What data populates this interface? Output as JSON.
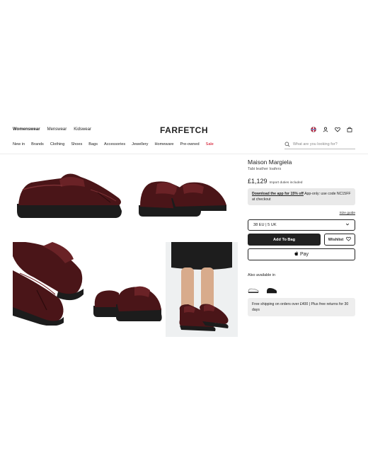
{
  "header": {
    "gender_tabs": [
      "Womenswear",
      "Menswear",
      "Kidswear"
    ],
    "logo": "FARFETCH",
    "categories": [
      "New in",
      "Brands",
      "Clothing",
      "Shoes",
      "Bags",
      "Accessories",
      "Jewellery",
      "Homeware",
      "Pre-owned",
      "Sale"
    ],
    "search_placeholder": "What are you looking for?",
    "icons": [
      "globe-icon",
      "user-icon",
      "heart-icon",
      "bag-icon",
      "search-icon"
    ]
  },
  "product": {
    "brand": "Maison Margiela",
    "name": "Tabi leather loafers",
    "price": "£1,129",
    "duties": "Import duties included",
    "promo_link": "Download the app for 15% off",
    "promo_text": " App-only: use code NC15FF at checkout",
    "size_guide": "Size guide",
    "selected_size": "38 EU | 5 UK",
    "add_to_bag": "Add To Bag",
    "wishlist": "Wishlist",
    "apple_pay": "Pay",
    "also_available": "Also available in",
    "shipping_note": "Free shipping on orders over £400 | Plus free returns for 30 days"
  },
  "colors": {
    "leather": "#4a1518",
    "sole": "#1c1c1c",
    "primary_button": "#222222",
    "sale": "#d0021b",
    "promo_bg": "#e9e9e9"
  }
}
